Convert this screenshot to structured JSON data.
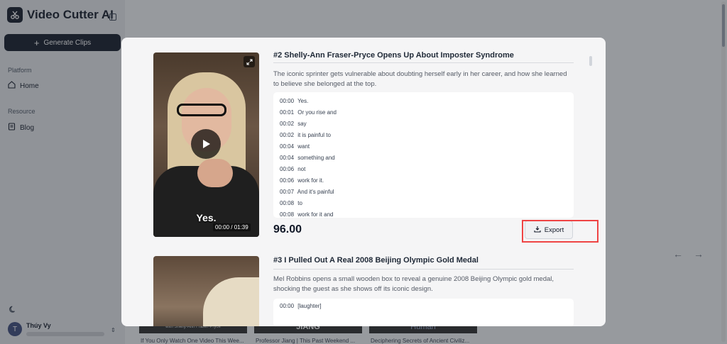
{
  "app": {
    "name": "Video Cutter AI"
  },
  "sidebar": {
    "generate_label": "Generate Clips",
    "platform_label": "Platform",
    "home_label": "Home",
    "resource_label": "Resource",
    "blog_label": "Blog",
    "user": {
      "initial": "T",
      "name": "Thúy Vy"
    }
  },
  "background": {
    "thumbnails": [
      {
        "overlay": "with Shelly-Ann Fraser-Pryce",
        "caption": "If You Only Watch One Video This Wee..."
      },
      {
        "overlay": "JIANG",
        "caption": "Professor Jiang | This Past Weekend ..."
      },
      {
        "overlay": "Human",
        "caption": "Deciphering Secrets of Ancient Civiliz..."
      }
    ]
  },
  "modal": {
    "clips": [
      {
        "title": "#2 Shelly-Ann Fraser-Pryce Opens Up About Imposter Syndrome",
        "description": "The iconic sprinter gets vulnerable about doubting herself early in her career, and how she learned to believe she belonged at the top.",
        "video": {
          "subtitle": "Yes.",
          "timecode": "00:00 / 01:39"
        },
        "transcript": [
          {
            "time": "00:00",
            "text": "Yes."
          },
          {
            "time": "00:01",
            "text": "Or you rise and"
          },
          {
            "time": "00:02",
            "text": "say"
          },
          {
            "time": "00:02",
            "text": "it is painful to"
          },
          {
            "time": "00:04",
            "text": "want"
          },
          {
            "time": "00:04",
            "text": "something and"
          },
          {
            "time": "00:06",
            "text": "not"
          },
          {
            "time": "00:06",
            "text": "work for it."
          },
          {
            "time": "00:07",
            "text": "And it's painful"
          },
          {
            "time": "00:08",
            "text": "to"
          },
          {
            "time": "00:08",
            "text": "work for it and"
          }
        ],
        "score": "96.00",
        "export_label": "Export"
      },
      {
        "title": "#3 I Pulled Out A Real 2008 Beijing Olympic Gold Medal",
        "description": "Mel Robbins opens a small wooden box to reveal a genuine 2008 Beijing Olympic gold medal, shocking the guest as she shows off its iconic design.",
        "transcript": [
          {
            "time": "00:00",
            "text": "[laughter]"
          }
        ]
      }
    ]
  },
  "colors": {
    "primary": "#111827",
    "highlight": "#ef4444"
  }
}
